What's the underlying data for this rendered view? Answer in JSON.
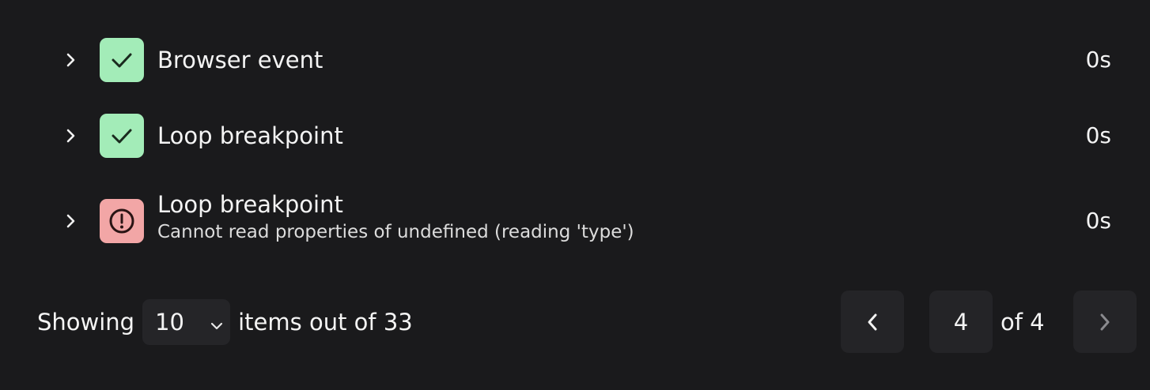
{
  "rows": [
    {
      "title": "Browser event",
      "subtitle": "",
      "status": "success",
      "status_icon": "check-icon",
      "duration": "0s"
    },
    {
      "title": "Loop breakpoint",
      "subtitle": "",
      "status": "success",
      "status_icon": "check-icon",
      "duration": "0s"
    },
    {
      "title": "Loop breakpoint",
      "subtitle": "Cannot read properties of undefined (reading 'type')",
      "status": "error",
      "status_icon": "alert-circle-icon",
      "duration": "0s"
    }
  ],
  "footer": {
    "showing_label": "Showing",
    "page_size": "10",
    "items_label": "items out of 33",
    "current_page": "4",
    "of_total": "of 4"
  },
  "colors": {
    "background": "#1a1a1c",
    "success": "#a3ecb8",
    "error": "#f2a6a6",
    "control": "#242427"
  }
}
